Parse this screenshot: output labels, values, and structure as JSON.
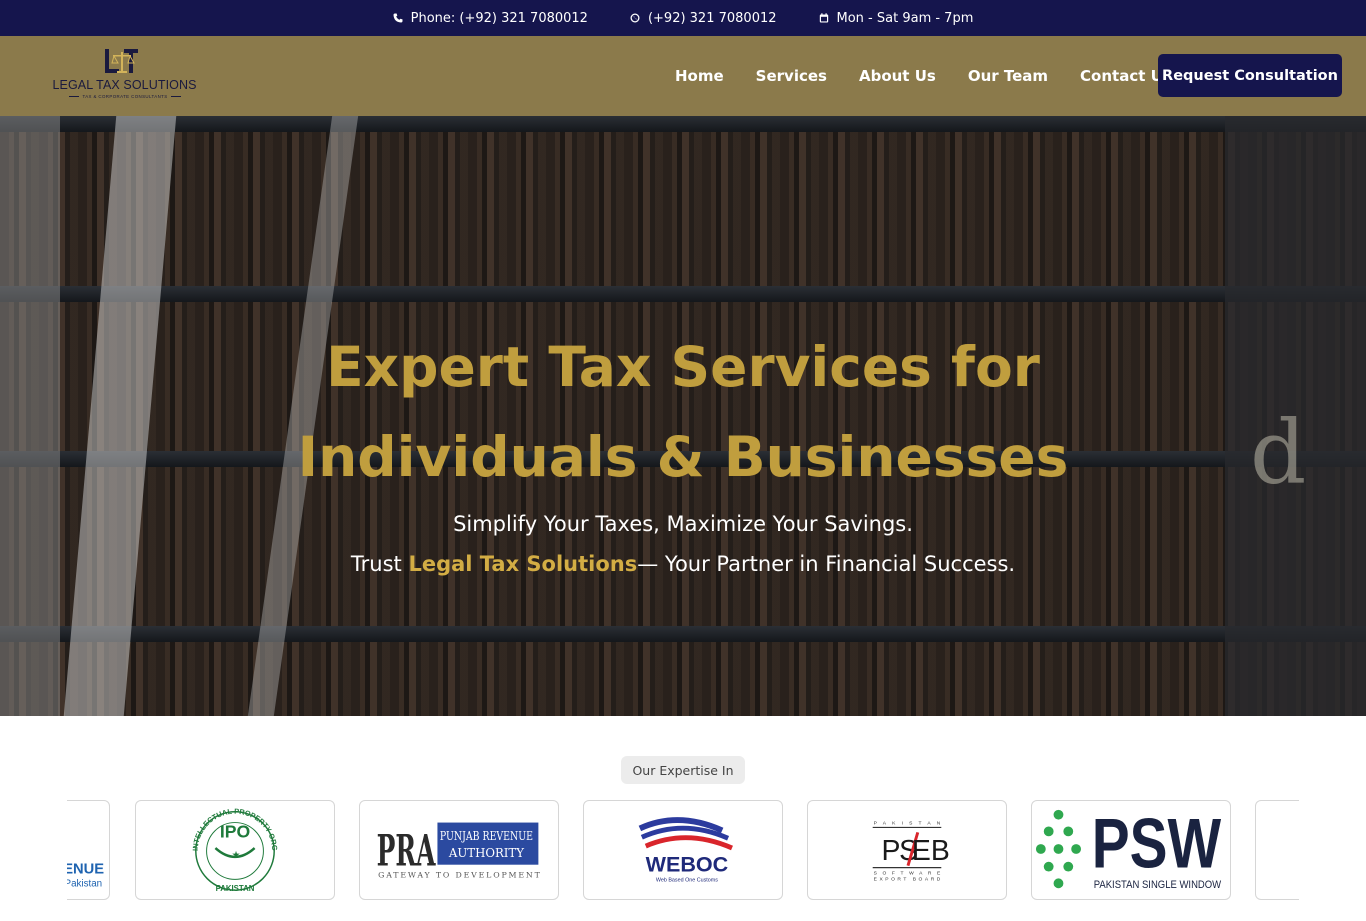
{
  "topbar": {
    "phone": "Phone: (+92) 321 7080012",
    "whatsapp": "(+92) 321 7080012",
    "hours": "Mon - Sat 9am - 7pm"
  },
  "brand": {
    "name": "LEGAL TAX SOLUTIONS",
    "tagline": "TAX & CORPORATE CONSULTANTS"
  },
  "nav": {
    "items": [
      "Home",
      "Services",
      "About Us",
      "Our Team",
      "Contact Us"
    ],
    "cta": "Request Consultation"
  },
  "hero": {
    "title_line1": "Expert Tax Services for",
    "title_line2": "Individuals & Businesses",
    "subtitle1": "Simplify Your Taxes, Maximize Your Savings.",
    "subtitle2_prefix": "Trust ",
    "subtitle2_brand": "Legal Tax Solutions",
    "subtitle2_suffix": "— Your Partner in Financial Success.",
    "decor_letter": "d"
  },
  "expertise": {
    "badge": "Our Expertise In",
    "logos": {
      "fbr": {
        "word": "VENUE",
        "sub": "Pakistan"
      },
      "ipo": {
        "abbr": "IPO",
        "ring": "INTELLECTUAL PROPERTY ORGANISATION",
        "country": "PAKISTAN"
      },
      "pra": {
        "abbr": "PRA",
        "name1": "PUNJAB REVENUE",
        "name2": "AUTHORITY",
        "slogan": "GATEWAY   TO DEVELOPMENT"
      },
      "weboc": {
        "name": "WEBOC",
        "sub": "Web Based One Customs"
      },
      "pseb": {
        "top": "PAKISTAN",
        "abbr1": "P",
        "abbr2": "S",
        "abbr3": "EB",
        "bottom1": "SOFTWARE",
        "bottom2": "EXPORT BOARD"
      },
      "psw": {
        "abbr": "PSW",
        "name": "PAKISTAN SINGLE WINDOW"
      }
    }
  },
  "colors": {
    "navy": "#15154d",
    "gold": "#c09e3e",
    "header_gold": "#8b7a4b"
  }
}
